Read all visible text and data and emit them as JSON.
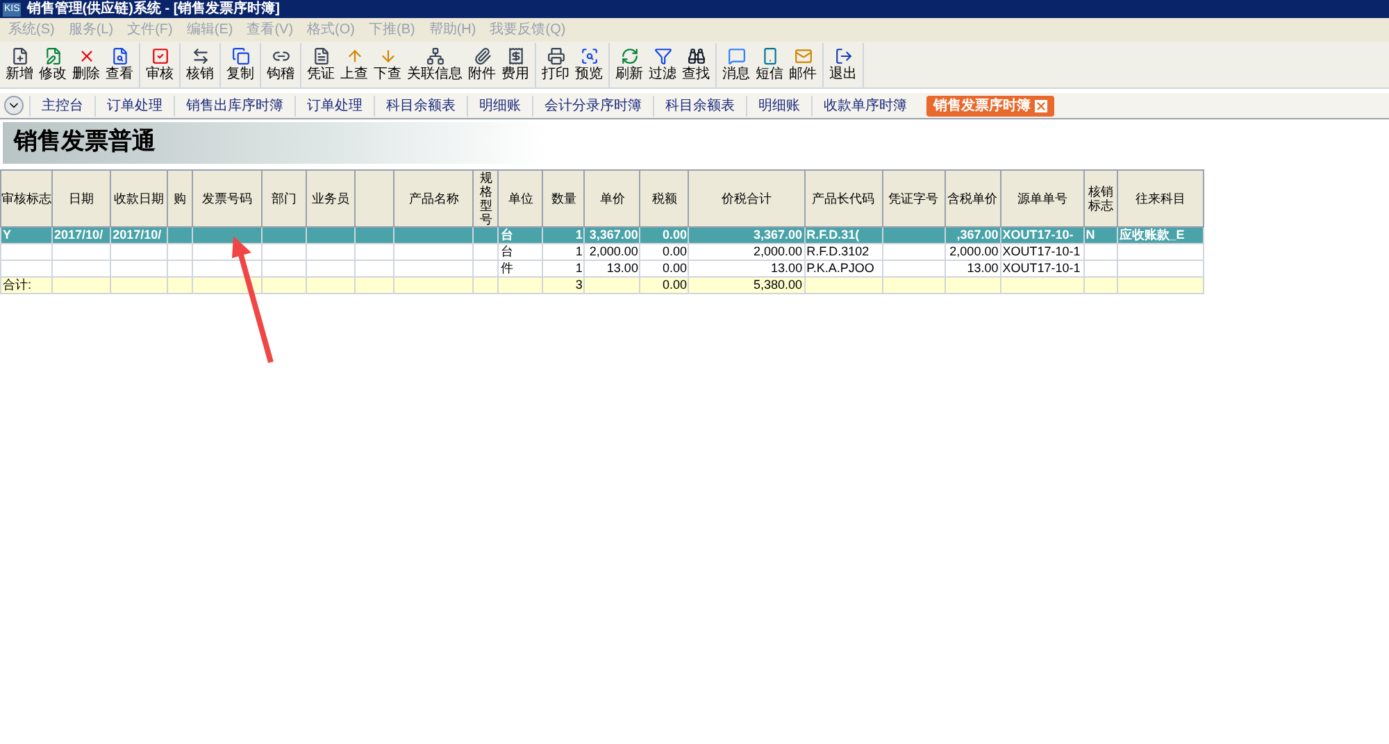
{
  "window": {
    "title": "销售管理(供应链)系统 - [销售发票序时簿]",
    "logo": "KIS"
  },
  "menu": [
    {
      "label": "系统(S)",
      "disabled": true
    },
    {
      "label": "服务(L)",
      "disabled": true
    },
    {
      "label": "文件(F)",
      "disabled": true
    },
    {
      "label": "编辑(E)",
      "disabled": true
    },
    {
      "label": "查看(V)",
      "disabled": true
    },
    {
      "label": "格式(O)",
      "disabled": true
    },
    {
      "label": "下推(B)",
      "disabled": true
    },
    {
      "label": "帮助(H)",
      "disabled": true
    },
    {
      "label": "我要反馈(Q)",
      "disabled": true
    }
  ],
  "toolbar": [
    [
      "新增",
      "修改",
      "删除",
      "查看"
    ],
    [
      "审核"
    ],
    [
      "核销"
    ],
    [
      "复制"
    ],
    [
      "钩稽"
    ],
    [
      "凭证",
      "上查",
      "下查",
      "关联信息",
      "附件",
      "费用"
    ],
    [
      "打印",
      "预览"
    ],
    [
      "刷新",
      "过滤",
      "查找"
    ],
    [
      "消息",
      "短信",
      "邮件"
    ],
    [
      "退出"
    ]
  ],
  "tabs": [
    {
      "label": "主控台",
      "selected": false
    },
    {
      "label": "订单处理",
      "selected": false
    },
    {
      "label": "销售出库序时簿",
      "selected": false
    },
    {
      "label": "订单处理",
      "selected": false
    },
    {
      "label": "科目余额表",
      "selected": false
    },
    {
      "label": "明细账",
      "selected": false
    },
    {
      "label": "会计分录序时簿",
      "selected": false
    },
    {
      "label": "科目余额表",
      "selected": false
    },
    {
      "label": "明细账",
      "selected": false
    },
    {
      "label": "收款单序时簿",
      "selected": false
    },
    {
      "label": "销售发票序时簿",
      "selected": true
    }
  ],
  "banner": {
    "title": "销售发票普通"
  },
  "table": {
    "columns": [
      {
        "label": "审核标志",
        "kind": "text"
      },
      {
        "label": "日期",
        "kind": "text"
      },
      {
        "label": "收款日期",
        "kind": "text"
      },
      {
        "label": "购",
        "kind": "text"
      },
      {
        "label": "发票号码",
        "kind": "text"
      },
      {
        "label": "部门",
        "kind": "text"
      },
      {
        "label": "业务员",
        "kind": "text"
      },
      {
        "kind": "text"
      },
      {
        "label": "产品名称",
        "kind": "text"
      },
      {
        "label": "规格型号",
        "kind": "text"
      },
      {
        "label": "单位",
        "kind": "text"
      },
      {
        "label": "数量",
        "kind": "number"
      },
      {
        "label": "单价",
        "kind": "number"
      },
      {
        "label": "税额",
        "kind": "number"
      },
      {
        "label": "价税合计",
        "kind": "number"
      },
      {
        "label": "产品长代码",
        "kind": "text"
      },
      {
        "label": "凭证字号",
        "kind": "text"
      },
      {
        "label": "含税单价",
        "kind": "number"
      },
      {
        "label": "源单单号",
        "kind": "text"
      },
      {
        "label": "核销标志",
        "kind": "text"
      },
      {
        "label": "往来科目",
        "kind": "text"
      }
    ],
    "rows": [
      {
        "kind": "data",
        "selected": true,
        "cells": [
          "Y",
          "2017/10/",
          "2017/10/",
          null,
          null,
          null,
          null,
          null,
          null,
          null,
          "台",
          "1",
          "3,367.00",
          "0.00",
          "3,367.00",
          "R.F.D.31(",
          null,
          ",367.00",
          "XOUT17-10-",
          "N",
          "应收账款_E"
        ]
      },
      {
        "kind": "data",
        "selected": false,
        "cells": [
          null,
          null,
          null,
          null,
          null,
          null,
          null,
          null,
          null,
          null,
          "台",
          "1",
          "2,000.00",
          "0.00",
          "2,000.00",
          "R.F.D.3102",
          null,
          "2,000.00",
          "XOUT17-10-1",
          null,
          null
        ]
      },
      {
        "kind": "data",
        "selected": false,
        "cells": [
          null,
          null,
          null,
          null,
          null,
          null,
          null,
          null,
          null,
          null,
          "件",
          "1",
          "13.00",
          "0.00",
          "13.00",
          "P.K.A.PJOO",
          null,
          "13.00",
          "XOUT17-10-1",
          null,
          null
        ]
      },
      {
        "kind": "total",
        "selected": false,
        "cells": [
          "合计:",
          null,
          null,
          null,
          null,
          null,
          null,
          null,
          null,
          null,
          null,
          "3",
          null,
          "0.00",
          "5,380.00",
          null,
          null,
          null,
          null,
          null,
          null
        ]
      }
    ]
  }
}
